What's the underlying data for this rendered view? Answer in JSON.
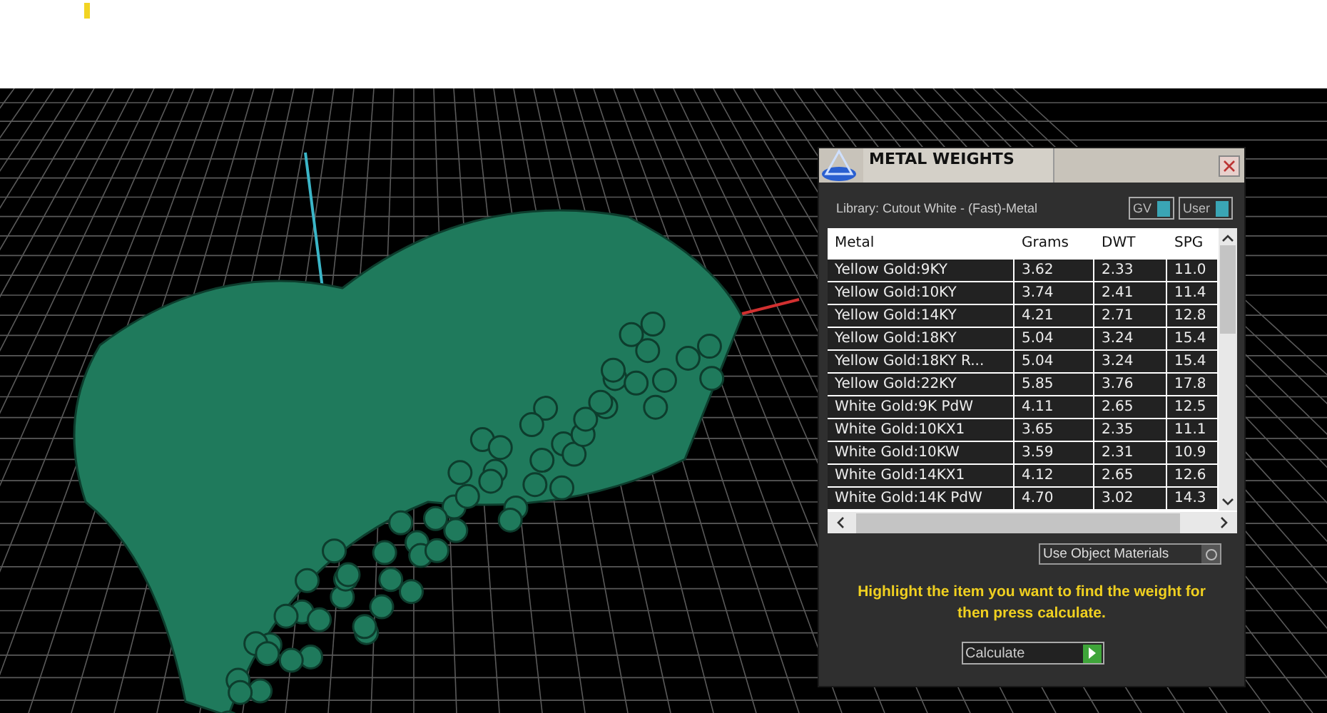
{
  "panel": {
    "title": "METAL WEIGHTS",
    "library": "Library: Cutout White - (Fast)-Metal",
    "toggles": [
      {
        "label": "GV",
        "on": true
      },
      {
        "label": "User",
        "on": true
      }
    ],
    "table": {
      "columns": [
        "Metal",
        "Grams",
        "DWT",
        "SPG"
      ],
      "rows": [
        [
          "Yellow Gold:9KY",
          "3.62",
          "2.33",
          "11.0"
        ],
        [
          "Yellow Gold:10KY",
          "3.74",
          "2.41",
          "11.4"
        ],
        [
          "Yellow Gold:14KY",
          "4.21",
          "2.71",
          "12.8"
        ],
        [
          "Yellow Gold:18KY",
          "5.04",
          "3.24",
          "15.4"
        ],
        [
          "Yellow Gold:18KY R...",
          "5.04",
          "3.24",
          "15.4"
        ],
        [
          "Yellow Gold:22KY",
          "5.85",
          "3.76",
          "17.8"
        ],
        [
          "White Gold:9K PdW",
          "4.11",
          "2.65",
          "12.5"
        ],
        [
          "White Gold:10KX1",
          "3.65",
          "2.35",
          "11.1"
        ],
        [
          "White Gold:10KW",
          "3.59",
          "2.31",
          "10.9"
        ],
        [
          "White Gold:14KX1",
          "4.12",
          "2.65",
          "12.6"
        ],
        [
          "White Gold:14K PdW",
          "4.70",
          "3.02",
          "14.3"
        ]
      ]
    },
    "use_object_materials": {
      "label": "Use Object Materials"
    },
    "hint": "Highlight the item you want to find the weight for then press calculate.",
    "calculate": "Calculate"
  }
}
